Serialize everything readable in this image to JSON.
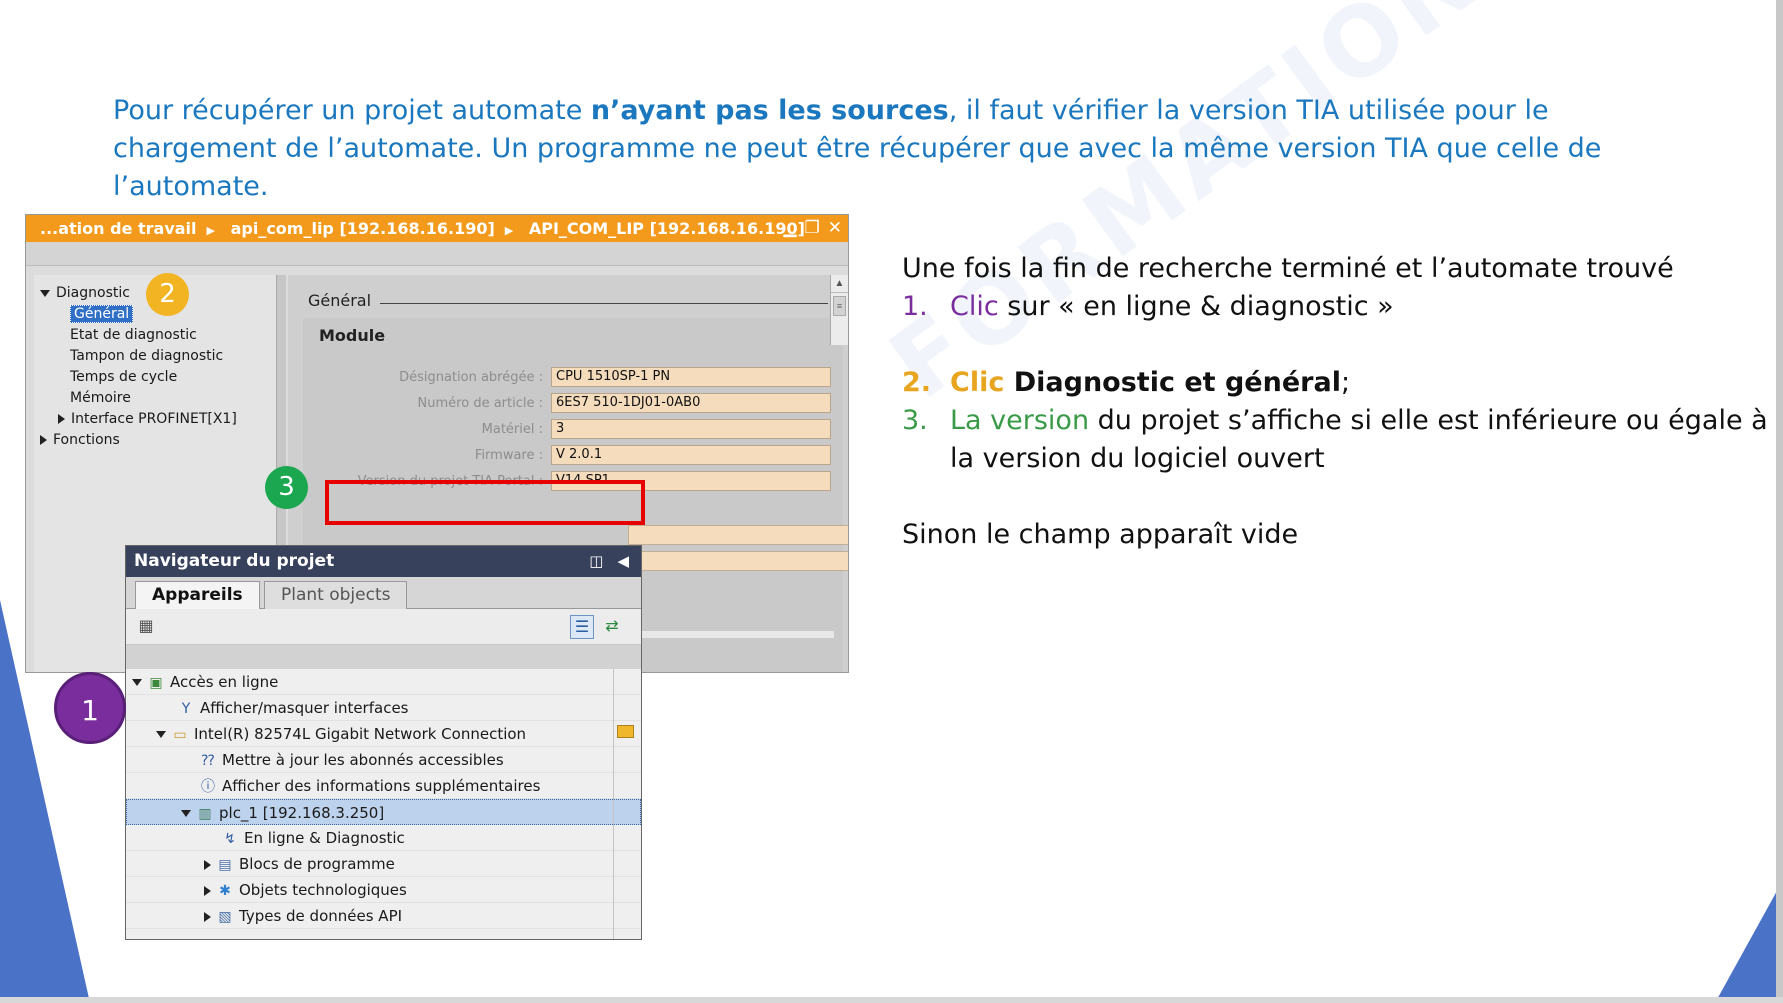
{
  "intro": {
    "part1": "Pour récupérer un projet automate ",
    "bold": "n’ayant pas les sources",
    "part2": ", il faut vérifier la version TIA utilisée pour le chargement de l’automate. Un programme ne peut être récupérer que avec la même version TIA que celle de l’automate."
  },
  "watermark": "FORMATION OUEST",
  "properties_window": {
    "breadcrumbs": [
      "...ation de travail",
      "api_com_lip [192.168.16.190]",
      "API_COM_LIP [192.168.16.190]"
    ],
    "window_controls": [
      "minimize",
      "restore",
      "close"
    ],
    "tree": {
      "diagnostic": "Diagnostic",
      "general": "Général",
      "etat": "Etat de diagnostic",
      "tampon": "Tampon de diagnostic",
      "temps": "Temps de cycle",
      "memoire": "Mémoire",
      "interface": "Interface PROFINET[X1]",
      "fonctions": "Fonctions"
    },
    "section_title": "Général",
    "module_title": "Module",
    "fields": [
      {
        "label": "Désignation abrégée :",
        "value": "CPU 1510SP-1 PN"
      },
      {
        "label": "Numéro de article :",
        "value": "6ES7 510-1DJ01-0AB0"
      },
      {
        "label": "Matériel :",
        "value": "3"
      },
      {
        "label": "Firmware :",
        "value": "V 2.0.1"
      },
      {
        "label": "Version du projet TIA Portal :",
        "value": "V14 SP1"
      }
    ]
  },
  "project_navigator": {
    "title": "Navigateur du projet",
    "tabs": [
      "Appareils",
      "Plant objects"
    ],
    "rows": [
      {
        "label": "Accès en ligne",
        "icon": "folder-online-icon"
      },
      {
        "label": "Afficher/masquer interfaces",
        "icon": "interface-icon"
      },
      {
        "label": "Intel(R) 82574L Gigabit Network Connection",
        "icon": "folder-icon"
      },
      {
        "label": "Mettre à jour les abonnés accessibles",
        "icon": "update-nodes-icon"
      },
      {
        "label": "Afficher des informations supplémentaires",
        "icon": "info-nodes-icon"
      },
      {
        "label": "plc_1 [192.168.3.250]",
        "icon": "plc-icon"
      },
      {
        "label": "En ligne & Diagnostic",
        "icon": "diagnostic-icon"
      },
      {
        "label": "Blocs de programme",
        "icon": "program-blocks-icon"
      },
      {
        "label": "Objets technologiques",
        "icon": "tech-objects-icon"
      },
      {
        "label": "Types de données API",
        "icon": "data-types-icon"
      }
    ]
  },
  "badges": {
    "one": "1",
    "two": "2",
    "three": "3"
  },
  "instructions": {
    "intro": "Une fois la fin de recherche terminé et l’automate trouvé",
    "step1_num": "1.",
    "step1_word": "Clic",
    "step1_rest": " sur « en ligne & diagnostic »",
    "step2_num": "2.",
    "step2_word": "Clic",
    "step2_bold": " Diagnostic et général",
    "step2_tail": ";",
    "step3_num": "3.",
    "step3_word": "La version",
    "step3_rest": " du projet s’affiche si elle est inférieure ou égale à la version du logiciel ouvert",
    "note": "Sinon le champ apparaît vide"
  },
  "colors": {
    "intro_blue": "#1b78bf",
    "title_orange": "#f39a1c",
    "badge_purple": "#7a2e9e",
    "badge_gold": "#f2b422",
    "badge_green": "#1aa74f",
    "highlight_red": "#e60000",
    "deco_blue": "#4a72c6"
  }
}
